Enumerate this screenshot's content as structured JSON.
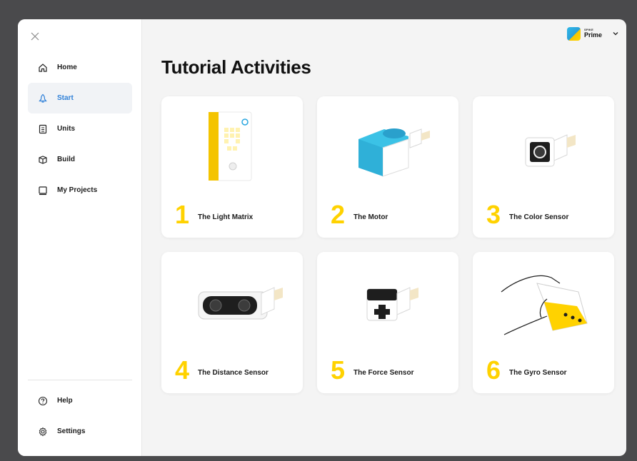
{
  "sidebar": {
    "close_icon": "close-icon",
    "nav": [
      {
        "label": "Home",
        "icon": "home-icon"
      },
      {
        "label": "Start",
        "icon": "rocket-icon",
        "active": true
      },
      {
        "label": "Units",
        "icon": "units-icon"
      },
      {
        "label": "Build",
        "icon": "build-icon"
      },
      {
        "label": "My Projects",
        "icon": "projects-icon"
      }
    ],
    "bottom": [
      {
        "label": "Help",
        "icon": "help-icon"
      },
      {
        "label": "Settings",
        "icon": "gear-icon"
      }
    ]
  },
  "header": {
    "hub_small": "SPIKE",
    "hub_name": "Prime"
  },
  "main": {
    "title": "Tutorial Activities",
    "cards": [
      {
        "number": "1",
        "title": "The Light Matrix"
      },
      {
        "number": "2",
        "title": "The Motor"
      },
      {
        "number": "3",
        "title": "The Color Sensor"
      },
      {
        "number": "4",
        "title": "The Distance Sensor"
      },
      {
        "number": "5",
        "title": "The Force Sensor"
      },
      {
        "number": "6",
        "title": "The Gyro Sensor"
      }
    ]
  },
  "colors": {
    "accent_yellow": "#ffd200",
    "active_blue": "#2f80d8",
    "background": "#f4f4f4"
  }
}
